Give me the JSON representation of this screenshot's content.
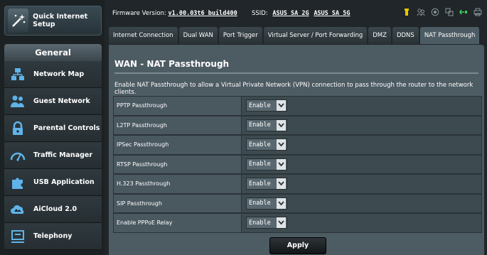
{
  "sidebar": {
    "quick_setup": "Quick Internet Setup",
    "general_header": "General",
    "items": [
      {
        "label": "Network Map",
        "icon": "network-map-icon"
      },
      {
        "label": "Guest Network",
        "icon": "guest-network-icon"
      },
      {
        "label": "Parental Controls",
        "icon": "lock-icon"
      },
      {
        "label": "Traffic Manager",
        "icon": "gauge-icon"
      },
      {
        "label": "USB Application",
        "icon": "puzzle-icon"
      },
      {
        "label": "AiCloud 2.0",
        "icon": "cloud-icon"
      },
      {
        "label": "Telephony",
        "icon": "telephony-icon"
      }
    ]
  },
  "topbar": {
    "firmware_label": "Firmware Version:",
    "firmware_value": "v1.00.03t6_build400",
    "ssid_label": "SSID:",
    "ssid_24": "ASUS_SA_2G",
    "ssid_5": "ASUS_SA_5G"
  },
  "tabs": [
    "Internet Connection",
    "Dual WAN",
    "Port Trigger",
    "Virtual Server / Port Forwarding",
    "DMZ",
    "DDNS",
    "NAT Passthrough"
  ],
  "active_tab": "NAT Passthrough",
  "panel": {
    "title": "WAN - NAT Passthrough",
    "description": "Enable NAT Passthrough to allow a Virtual Private Network (VPN) connection to pass through the router to the network clients.",
    "rows": [
      {
        "label": "PPTP Passthrough",
        "value": "Enable"
      },
      {
        "label": "L2TP Passthrough",
        "value": "Enable"
      },
      {
        "label": "IPSec Passthrough",
        "value": "Enable"
      },
      {
        "label": "RTSP Passthrough",
        "value": "Enable"
      },
      {
        "label": "H.323 Passthrough",
        "value": "Enable"
      },
      {
        "label": "SIP Passthrough",
        "value": "Enable"
      },
      {
        "label": "Enable PPPoE Relay",
        "value": "Enable"
      }
    ],
    "apply_label": "Apply"
  },
  "colors": {
    "accent": "#4d5b63",
    "background": "#202629",
    "usb_status": "#e8c800",
    "wan_status": "#3cd05a"
  }
}
